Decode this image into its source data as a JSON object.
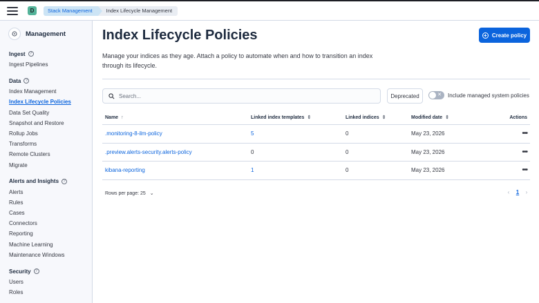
{
  "topbar": {
    "space_initial": "D",
    "breadcrumbs": [
      "Stack Management",
      "Index Lifecycle Management"
    ]
  },
  "sidebar": {
    "title": "Management",
    "groups": [
      {
        "title": "Ingest",
        "items": [
          "Ingest Pipelines"
        ]
      },
      {
        "title": "Data",
        "items": [
          "Index Management",
          "Index Lifecycle Policies",
          "Data Set Quality",
          "Snapshot and Restore",
          "Rollup Jobs",
          "Transforms",
          "Remote Clusters",
          "Migrate"
        ]
      },
      {
        "title": "Alerts and Insights",
        "items": [
          "Alerts",
          "Rules",
          "Cases",
          "Connectors",
          "Reporting",
          "Machine Learning",
          "Maintenance Windows"
        ]
      },
      {
        "title": "Security",
        "items": [
          "Users",
          "Roles"
        ]
      }
    ],
    "active_item": "Index Lifecycle Policies"
  },
  "main": {
    "title": "Index Lifecycle Policies",
    "create_label": "Create policy",
    "description": "Manage your indices as they age. Attach a policy to automate when and how to transition an index through its lifecycle.",
    "search_placeholder": "Search...",
    "deprecated_label": "Deprecated",
    "toggle_label": "Include managed system policies",
    "columns": {
      "name": "Name",
      "templates": "Linked index templates",
      "indices": "Linked indices",
      "modified": "Modified date",
      "actions": "Actions"
    },
    "rows": [
      {
        "name": ".monitoring-8-ilm-policy",
        "templates": "5",
        "indices": "0",
        "modified": "May 23, 2026"
      },
      {
        "name": ".preview.alerts-security.alerts-policy",
        "templates": "0",
        "indices": "0",
        "modified": "May 23, 2026"
      },
      {
        "name": "kibana-reporting",
        "templates": "1",
        "indices": "0",
        "modified": "May 23, 2026"
      }
    ],
    "rows_per_page": "Rows per page: 25",
    "current_page": "1"
  },
  "colors": {
    "accent": "#0b64dd",
    "sidebar_bg": "#f7f8fc",
    "text": "#1d2a3e"
  }
}
